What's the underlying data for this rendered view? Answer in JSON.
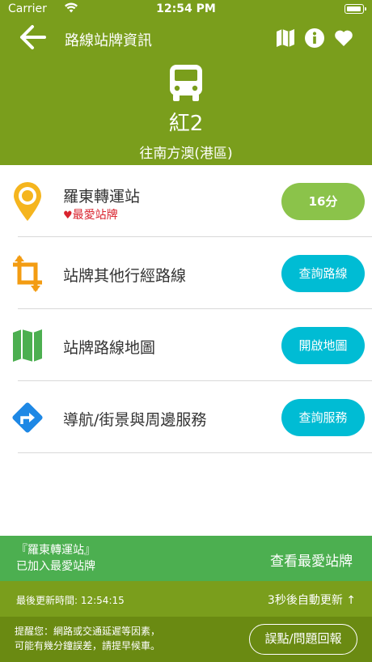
{
  "status_bar": {
    "carrier": "Carrier",
    "time": "12:54 PM"
  },
  "nav": {
    "title": "路線站牌資訊"
  },
  "route": {
    "name": "紅2",
    "direction": "往南方澳(港區)"
  },
  "stop": {
    "name": "羅東轉運站",
    "favorite_label": "最愛站牌",
    "eta": "16分"
  },
  "rows": [
    {
      "label": "站牌其他行經路線",
      "button": "查詢路線"
    },
    {
      "label": "站牌路線地圖",
      "button": "開啟地圖"
    },
    {
      "label": "導航/街景與周邊服務",
      "button": "查詢服務"
    }
  ],
  "favorite_bar": {
    "line1": "『羅東轉運站』",
    "line2": "已加入最愛站牌",
    "button": "查看最愛站牌"
  },
  "update_bar": {
    "last_updated": "最後更新時間: 12:54:15",
    "auto_refresh": "3秒後自動更新 ↑"
  },
  "notice": {
    "line1": "提醒您：網路或交通延遲等因素，",
    "line2": "可能有幾分鐘誤差，請提早候車。",
    "button": "誤點/問題回報"
  },
  "colors": {
    "header_green": "#7a9e1c",
    "fav_green": "#4caf50",
    "pill_green": "#8bc34a",
    "pill_cyan": "#00bcd4",
    "favorite_red": "#d9232e",
    "pin_yellow": "#f5b51e",
    "swap_orange": "#f39c12",
    "map_green": "#4caf50",
    "nav_blue": "#1e88e5"
  },
  "icons": [
    "back-arrow-icon",
    "map-icon",
    "info-icon",
    "heart-icon",
    "bus-icon",
    "location-pin-icon",
    "crop-transfer-icon",
    "folded-map-icon",
    "directions-icon"
  ]
}
